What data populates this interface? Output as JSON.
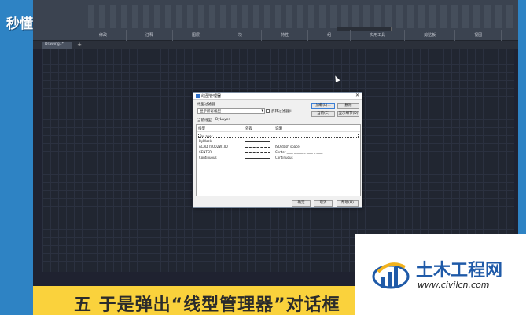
{
  "logo": "秒懂视频",
  "ribbon": {
    "groups": [
      "修改",
      "注释",
      "图层",
      "块",
      "特性",
      "组",
      "实用工具",
      "剪贴板",
      "视图"
    ]
  },
  "tabs": {
    "document": "Drawing1*",
    "add": "+"
  },
  "dialog": {
    "title": "线型管理器",
    "filter_label": "线型过滤器",
    "filter_value": "显示所有线型",
    "invert_label": "反转过滤器(I)",
    "load_button": "加载(L)...",
    "delete_button": "删除",
    "current_button": "当前(C)",
    "details_button": "显示细节(D)",
    "current_linetype_label": "当前线型:",
    "current_linetype_value": "ByLayer",
    "columns": {
      "linetype": "线型",
      "appearance": "外观",
      "description": "说明"
    },
    "rows": [
      {
        "name": "ByLayer",
        "description": ""
      },
      {
        "name": "ByBlock",
        "description": ""
      },
      {
        "name": "ACAD_ISO02W100",
        "description": "ISO dash space __ __ __ __ __ __"
      },
      {
        "name": "CENTER",
        "description": "Center ____ _ ____ _ ____ _ ____"
      },
      {
        "name": "Continuous",
        "description": "Continuous"
      }
    ],
    "ok_button": "确定",
    "cancel_button": "取消",
    "help_button": "帮助(H)"
  },
  "caption": "五 于是弹出“线型管理器”对话框",
  "watermark": {
    "name": "土木工程网",
    "url": "www.civilcn.com"
  },
  "colors": {
    "background": "#2e83c4",
    "caption_bar": "#fad23c",
    "canvas": "#212631",
    "watermark_blue": "#1f5aa8"
  }
}
